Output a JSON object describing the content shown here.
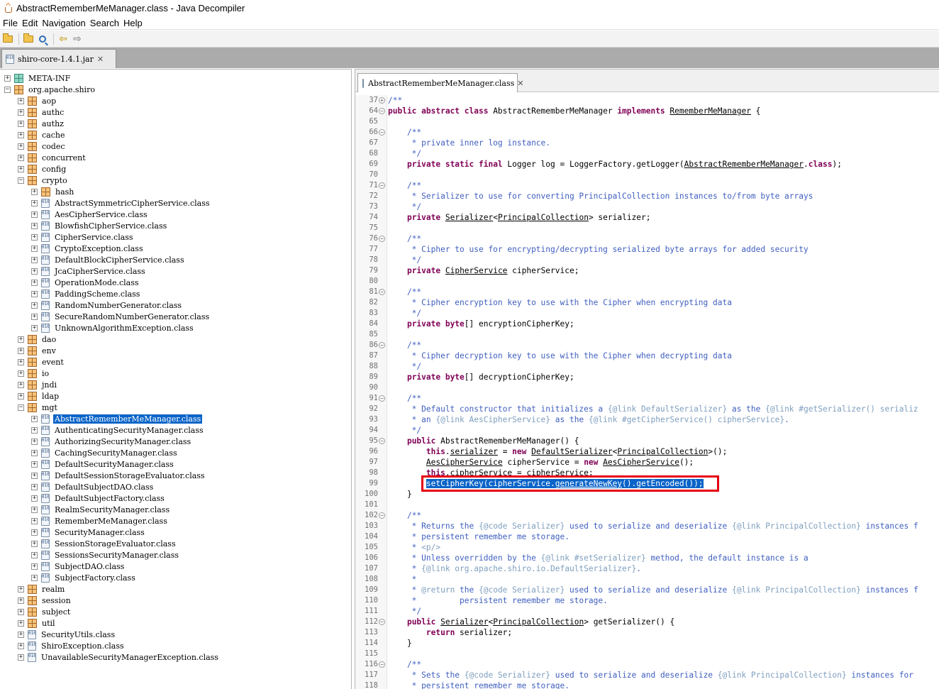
{
  "window": {
    "title": "AbstractRememberMeManager.class - Java Decompiler"
  },
  "menu": [
    "File",
    "Edit",
    "Navigation",
    "Search",
    "Help"
  ],
  "toolbar": {
    "icons": [
      "open-file-icon",
      "open-type-icon",
      "search-icon",
      "back-arrow-icon",
      "forward-arrow-icon"
    ]
  },
  "jar_tab": {
    "label": "shiro-core-1.4.1.jar",
    "close": "✕"
  },
  "editor_tab": {
    "label": "AbstractRememberMeManager.class",
    "close": "✕"
  },
  "tree": [
    {
      "label": "META-INF",
      "type": "folder",
      "depth": 0,
      "exp": "+"
    },
    {
      "label": "org.apache.shiro",
      "type": "package",
      "depth": 0,
      "exp": "−"
    },
    {
      "label": "aop",
      "type": "package",
      "depth": 1,
      "exp": "+"
    },
    {
      "label": "authc",
      "type": "package",
      "depth": 1,
      "exp": "+"
    },
    {
      "label": "authz",
      "type": "package",
      "depth": 1,
      "exp": "+"
    },
    {
      "label": "cache",
      "type": "package",
      "depth": 1,
      "exp": "+"
    },
    {
      "label": "codec",
      "type": "package",
      "depth": 1,
      "exp": "+"
    },
    {
      "label": "concurrent",
      "type": "package",
      "depth": 1,
      "exp": "+"
    },
    {
      "label": "config",
      "type": "package",
      "depth": 1,
      "exp": "+"
    },
    {
      "label": "crypto",
      "type": "package",
      "depth": 1,
      "exp": "−"
    },
    {
      "label": "hash",
      "type": "package",
      "depth": 2,
      "exp": "+"
    },
    {
      "label": "AbstractSymmetricCipherService.class",
      "type": "class",
      "depth": 2,
      "exp": "+"
    },
    {
      "label": "AesCipherService.class",
      "type": "class",
      "depth": 2,
      "exp": "+"
    },
    {
      "label": "BlowfishCipherService.class",
      "type": "class",
      "depth": 2,
      "exp": "+"
    },
    {
      "label": "CipherService.class",
      "type": "class",
      "depth": 2,
      "exp": "+"
    },
    {
      "label": "CryptoException.class",
      "type": "class",
      "depth": 2,
      "exp": "+"
    },
    {
      "label": "DefaultBlockCipherService.class",
      "type": "class",
      "depth": 2,
      "exp": "+"
    },
    {
      "label": "JcaCipherService.class",
      "type": "class",
      "depth": 2,
      "exp": "+"
    },
    {
      "label": "OperationMode.class",
      "type": "class",
      "depth": 2,
      "exp": "+"
    },
    {
      "label": "PaddingScheme.class",
      "type": "class",
      "depth": 2,
      "exp": "+"
    },
    {
      "label": "RandomNumberGenerator.class",
      "type": "class",
      "depth": 2,
      "exp": "+"
    },
    {
      "label": "SecureRandomNumberGenerator.class",
      "type": "class",
      "depth": 2,
      "exp": "+"
    },
    {
      "label": "UnknownAlgorithmException.class",
      "type": "class",
      "depth": 2,
      "exp": "+"
    },
    {
      "label": "dao",
      "type": "package",
      "depth": 1,
      "exp": "+"
    },
    {
      "label": "env",
      "type": "package",
      "depth": 1,
      "exp": "+"
    },
    {
      "label": "event",
      "type": "package",
      "depth": 1,
      "exp": "+"
    },
    {
      "label": "io",
      "type": "package",
      "depth": 1,
      "exp": "+"
    },
    {
      "label": "jndi",
      "type": "package",
      "depth": 1,
      "exp": "+"
    },
    {
      "label": "ldap",
      "type": "package",
      "depth": 1,
      "exp": "+"
    },
    {
      "label": "mgt",
      "type": "package",
      "depth": 1,
      "exp": "−"
    },
    {
      "label": "AbstractRememberMeManager.class",
      "type": "class",
      "depth": 2,
      "exp": "+",
      "selected": true
    },
    {
      "label": "AuthenticatingSecurityManager.class",
      "type": "class",
      "depth": 2,
      "exp": "+"
    },
    {
      "label": "AuthorizingSecurityManager.class",
      "type": "class",
      "depth": 2,
      "exp": "+"
    },
    {
      "label": "CachingSecurityManager.class",
      "type": "class",
      "depth": 2,
      "exp": "+"
    },
    {
      "label": "DefaultSecurityManager.class",
      "type": "class",
      "depth": 2,
      "exp": "+"
    },
    {
      "label": "DefaultSessionStorageEvaluator.class",
      "type": "class",
      "depth": 2,
      "exp": "+"
    },
    {
      "label": "DefaultSubjectDAO.class",
      "type": "class",
      "depth": 2,
      "exp": "+"
    },
    {
      "label": "DefaultSubjectFactory.class",
      "type": "class",
      "depth": 2,
      "exp": "+"
    },
    {
      "label": "RealmSecurityManager.class",
      "type": "class",
      "depth": 2,
      "exp": "+"
    },
    {
      "label": "RememberMeManager.class",
      "type": "class",
      "depth": 2,
      "exp": "+"
    },
    {
      "label": "SecurityManager.class",
      "type": "class",
      "depth": 2,
      "exp": "+"
    },
    {
      "label": "SessionStorageEvaluator.class",
      "type": "class",
      "depth": 2,
      "exp": "+"
    },
    {
      "label": "SessionsSecurityManager.class",
      "type": "class",
      "depth": 2,
      "exp": "+"
    },
    {
      "label": "SubjectDAO.class",
      "type": "class",
      "depth": 2,
      "exp": "+"
    },
    {
      "label": "SubjectFactory.class",
      "type": "class",
      "depth": 2,
      "exp": "+"
    },
    {
      "label": "realm",
      "type": "package",
      "depth": 1,
      "exp": "+"
    },
    {
      "label": "session",
      "type": "package",
      "depth": 1,
      "exp": "+"
    },
    {
      "label": "subject",
      "type": "package",
      "depth": 1,
      "exp": "+"
    },
    {
      "label": "util",
      "type": "package",
      "depth": 1,
      "exp": "+"
    },
    {
      "label": "SecurityUtils.class",
      "type": "class",
      "depth": 1,
      "exp": "+"
    },
    {
      "label": "ShiroException.class",
      "type": "class",
      "depth": 1,
      "exp": "+"
    },
    {
      "label": "UnavailableSecurityManagerException.class",
      "type": "class",
      "depth": 1,
      "exp": "+"
    }
  ],
  "code": [
    {
      "n": "37",
      "fold": "+",
      "segs": [
        [
          "cm",
          "/**"
        ]
      ]
    },
    {
      "n": "64",
      "fold": "-",
      "segs": [
        [
          "kw",
          "public abstract class"
        ],
        [
          "",
          " AbstractRememberMeManager "
        ],
        [
          "kw",
          "implements"
        ],
        [
          "",
          " "
        ],
        [
          "ref",
          "RememberMeManager"
        ],
        [
          "",
          " {"
        ]
      ]
    },
    {
      "n": "65",
      "segs": []
    },
    {
      "n": "66",
      "fold": "-",
      "segs": [
        [
          "",
          "    "
        ],
        [
          "cm",
          "/**"
        ]
      ]
    },
    {
      "n": "67",
      "segs": [
        [
          "cm",
          "     * private inner log instance."
        ]
      ]
    },
    {
      "n": "68",
      "segs": [
        [
          "cm",
          "     */"
        ]
      ]
    },
    {
      "n": "69",
      "segs": [
        [
          "",
          "    "
        ],
        [
          "kw",
          "private static final"
        ],
        [
          "",
          " Logger log = LoggerFactory.getLogger("
        ],
        [
          "ref",
          "AbstractRememberMeManager"
        ],
        [
          "",
          "."
        ],
        [
          "kw",
          "class"
        ],
        [
          "",
          ");"
        ]
      ]
    },
    {
      "n": "70",
      "segs": []
    },
    {
      "n": "71",
      "fold": "-",
      "segs": [
        [
          "",
          "    "
        ],
        [
          "cm",
          "/**"
        ]
      ]
    },
    {
      "n": "72",
      "segs": [
        [
          "cm",
          "     * Serializer to use for converting PrincipalCollection instances to/from byte arrays"
        ]
      ]
    },
    {
      "n": "73",
      "segs": [
        [
          "cm",
          "     */"
        ]
      ]
    },
    {
      "n": "74",
      "segs": [
        [
          "",
          "    "
        ],
        [
          "kw",
          "private"
        ],
        [
          "",
          " "
        ],
        [
          "ref",
          "Serializer"
        ],
        [
          "",
          "<"
        ],
        [
          "ref",
          "PrincipalCollection"
        ],
        [
          "",
          "> serializer;"
        ]
      ]
    },
    {
      "n": "75",
      "segs": []
    },
    {
      "n": "76",
      "fold": "-",
      "segs": [
        [
          "",
          "    "
        ],
        [
          "cm",
          "/**"
        ]
      ]
    },
    {
      "n": "77",
      "segs": [
        [
          "cm",
          "     * Cipher to use for encrypting/decrypting serialized byte arrays for added security"
        ]
      ]
    },
    {
      "n": "78",
      "segs": [
        [
          "cm",
          "     */"
        ]
      ]
    },
    {
      "n": "79",
      "segs": [
        [
          "",
          "    "
        ],
        [
          "kw",
          "private"
        ],
        [
          "",
          " "
        ],
        [
          "ref",
          "CipherService"
        ],
        [
          "",
          " cipherService;"
        ]
      ]
    },
    {
      "n": "80",
      "segs": []
    },
    {
      "n": "81",
      "fold": "-",
      "segs": [
        [
          "",
          "    "
        ],
        [
          "cm",
          "/**"
        ]
      ]
    },
    {
      "n": "82",
      "segs": [
        [
          "cm",
          "     * Cipher encryption key to use with the Cipher when encrypting data"
        ]
      ]
    },
    {
      "n": "83",
      "segs": [
        [
          "cm",
          "     */"
        ]
      ]
    },
    {
      "n": "84",
      "segs": [
        [
          "",
          "    "
        ],
        [
          "kw",
          "private byte"
        ],
        [
          "",
          "[] encryptionCipherKey;"
        ]
      ]
    },
    {
      "n": "85",
      "segs": []
    },
    {
      "n": "86",
      "fold": "-",
      "segs": [
        [
          "",
          "    "
        ],
        [
          "cm",
          "/**"
        ]
      ]
    },
    {
      "n": "87",
      "segs": [
        [
          "cm",
          "     * Cipher decryption key to use with the Cipher when decrypting data"
        ]
      ]
    },
    {
      "n": "88",
      "segs": [
        [
          "cm",
          "     */"
        ]
      ]
    },
    {
      "n": "89",
      "segs": [
        [
          "",
          "    "
        ],
        [
          "kw",
          "private byte"
        ],
        [
          "",
          "[] decryptionCipherKey;"
        ]
      ]
    },
    {
      "n": "90",
      "segs": []
    },
    {
      "n": "91",
      "fold": "-",
      "segs": [
        [
          "",
          "    "
        ],
        [
          "cm",
          "/**"
        ]
      ]
    },
    {
      "n": "92",
      "segs": [
        [
          "cm",
          "     * Default constructor that initializes a "
        ],
        [
          "tag",
          "{@link DefaultSerializer}"
        ],
        [
          "cm",
          " as the "
        ],
        [
          "tag",
          "{@link #getSerializer() serializ"
        ]
      ]
    },
    {
      "n": "93",
      "segs": [
        [
          "cm",
          "     * an "
        ],
        [
          "tag",
          "{@link AesCipherService}"
        ],
        [
          "cm",
          " as the "
        ],
        [
          "tag",
          "{@link #getCipherService() cipherService}"
        ],
        [
          "cm",
          "."
        ]
      ]
    },
    {
      "n": "94",
      "segs": [
        [
          "cm",
          "     */"
        ]
      ]
    },
    {
      "n": "95",
      "fold": "-",
      "segs": [
        [
          "",
          "    "
        ],
        [
          "kw",
          "public"
        ],
        [
          "",
          " AbstractRememberMeManager() {"
        ]
      ]
    },
    {
      "n": "96",
      "segs": [
        [
          "",
          "        "
        ],
        [
          "kw",
          "this"
        ],
        [
          "",
          "."
        ],
        [
          "ref",
          "serializer"
        ],
        [
          "",
          " = "
        ],
        [
          "kw",
          "new"
        ],
        [
          "",
          " "
        ],
        [
          "ref",
          "DefaultSerializer"
        ],
        [
          "",
          "<"
        ],
        [
          "ref",
          "PrincipalCollection"
        ],
        [
          "",
          ">();"
        ]
      ]
    },
    {
      "n": "97",
      "segs": [
        [
          "",
          "        "
        ],
        [
          "ref",
          "AesCipherService"
        ],
        [
          "",
          " cipherService = "
        ],
        [
          "kw",
          "new"
        ],
        [
          "",
          " "
        ],
        [
          "ref",
          "AesCipherService"
        ],
        [
          "",
          "();"
        ]
      ]
    },
    {
      "n": "98",
      "segs": [
        [
          "",
          "        "
        ],
        [
          "kw",
          "this"
        ],
        [
          "",
          ".cipherService = cipherService;"
        ]
      ]
    },
    {
      "n": "99",
      "segs": [
        [
          "",
          "        "
        ],
        [
          "sel",
          "setCipherKey(cipherService."
        ],
        [
          "sel ref",
          "generateNewKey"
        ],
        [
          "sel",
          "().getEncoded());"
        ]
      ]
    },
    {
      "n": "100",
      "segs": [
        [
          "",
          "    }"
        ]
      ]
    },
    {
      "n": "101",
      "segs": []
    },
    {
      "n": "102",
      "fold": "-",
      "segs": [
        [
          "",
          "    "
        ],
        [
          "cm",
          "/**"
        ]
      ]
    },
    {
      "n": "103",
      "segs": [
        [
          "cm",
          "     * Returns the "
        ],
        [
          "tag",
          "{@code Serializer}"
        ],
        [
          "cm",
          " used to serialize and deserialize "
        ],
        [
          "tag",
          "{@link PrincipalCollection}"
        ],
        [
          "cm",
          " instances f"
        ]
      ]
    },
    {
      "n": "104",
      "segs": [
        [
          "cm",
          "     * persistent remember me storage."
        ]
      ]
    },
    {
      "n": "105",
      "segs": [
        [
          "cm",
          "     * "
        ],
        [
          "tag",
          "<p/>"
        ]
      ]
    },
    {
      "n": "106",
      "segs": [
        [
          "cm",
          "     * Unless overridden by the "
        ],
        [
          "tag",
          "{@link #setSerializer}"
        ],
        [
          "cm",
          " method, the default instance is a"
        ]
      ]
    },
    {
      "n": "107",
      "segs": [
        [
          "cm",
          "     * "
        ],
        [
          "tag",
          "{@link org.apache.shiro.io.DefaultSerializer}"
        ],
        [
          "cm",
          "."
        ]
      ]
    },
    {
      "n": "108",
      "segs": [
        [
          "cm",
          "     *"
        ]
      ]
    },
    {
      "n": "109",
      "segs": [
        [
          "cm",
          "     * "
        ],
        [
          "tag",
          "@return"
        ],
        [
          "cm",
          " the "
        ],
        [
          "tag",
          "{@code Serializer}"
        ],
        [
          "cm",
          " used to serialize and deserialize "
        ],
        [
          "tag",
          "{@link PrincipalCollection}"
        ],
        [
          "cm",
          " instances f"
        ]
      ]
    },
    {
      "n": "110",
      "segs": [
        [
          "cm",
          "     *         persistent remember me storage."
        ]
      ]
    },
    {
      "n": "111",
      "segs": [
        [
          "cm",
          "     */"
        ]
      ]
    },
    {
      "n": "112",
      "fold": "-",
      "segs": [
        [
          "",
          "    "
        ],
        [
          "kw",
          "public"
        ],
        [
          "",
          " "
        ],
        [
          "ref",
          "Serializer"
        ],
        [
          "",
          "<"
        ],
        [
          "ref",
          "PrincipalCollection"
        ],
        [
          "",
          "> getSerializer() {"
        ]
      ]
    },
    {
      "n": "113",
      "segs": [
        [
          "",
          "        "
        ],
        [
          "kw",
          "return"
        ],
        [
          "",
          " serializer;"
        ]
      ]
    },
    {
      "n": "114",
      "segs": [
        [
          "",
          "    }"
        ]
      ]
    },
    {
      "n": "115",
      "segs": []
    },
    {
      "n": "116",
      "fold": "-",
      "segs": [
        [
          "",
          "    "
        ],
        [
          "cm",
          "/**"
        ]
      ]
    },
    {
      "n": "117",
      "segs": [
        [
          "cm",
          "     * Sets the "
        ],
        [
          "tag",
          "{@code Serializer}"
        ],
        [
          "cm",
          " used to serialize and deserialize "
        ],
        [
          "tag",
          "{@link PrincipalCollection}"
        ],
        [
          "cm",
          " instances for"
        ]
      ]
    },
    {
      "n": "118",
      "segs": [
        [
          "cm",
          "     * persistent remember me storage."
        ]
      ]
    }
  ]
}
